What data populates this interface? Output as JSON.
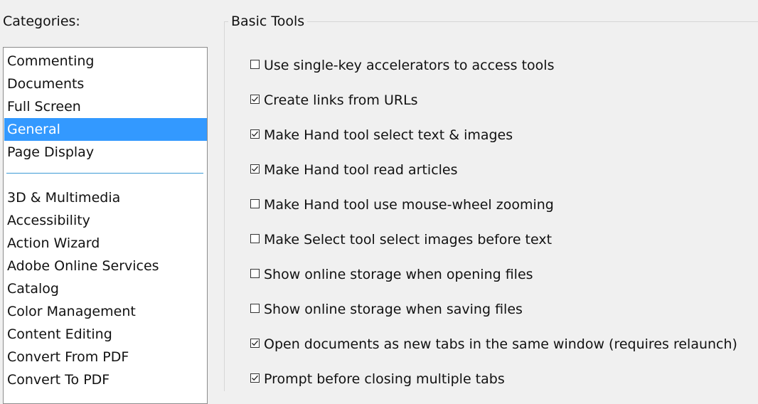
{
  "categories_label": "Categories:",
  "categories": {
    "top_items": [
      {
        "label": "Commenting",
        "selected": false
      },
      {
        "label": "Documents",
        "selected": false
      },
      {
        "label": "Full Screen",
        "selected": false
      },
      {
        "label": "General",
        "selected": true
      },
      {
        "label": "Page Display",
        "selected": false
      }
    ],
    "other_items": [
      {
        "label": "3D & Multimedia"
      },
      {
        "label": "Accessibility"
      },
      {
        "label": "Action Wizard"
      },
      {
        "label": "Adobe Online Services"
      },
      {
        "label": "Catalog"
      },
      {
        "label": "Color Management"
      },
      {
        "label": "Content Editing"
      },
      {
        "label": "Convert From PDF"
      },
      {
        "label": "Convert To PDF"
      }
    ]
  },
  "basic_tools": {
    "title": "Basic Tools",
    "options": [
      {
        "label": "Use single-key accelerators to access tools",
        "checked": false
      },
      {
        "label": "Create links from URLs",
        "checked": true
      },
      {
        "label": "Make Hand tool select text & images",
        "checked": true
      },
      {
        "label": "Make Hand tool read articles",
        "checked": true
      },
      {
        "label": "Make Hand tool use mouse-wheel zooming",
        "checked": false
      },
      {
        "label": "Make Select tool select images before text",
        "checked": false
      },
      {
        "label": "Show online storage when opening files",
        "checked": false
      },
      {
        "label": "Show online storage when saving files",
        "checked": false
      },
      {
        "label": "Open documents as new tabs in the same window (requires relaunch)",
        "checked": true
      },
      {
        "label": "Prompt before closing multiple tabs",
        "checked": true
      }
    ]
  },
  "colors": {
    "selection": "#3399ff",
    "separator": "#3c9ad6",
    "panel_background": "#f0f0f0"
  }
}
